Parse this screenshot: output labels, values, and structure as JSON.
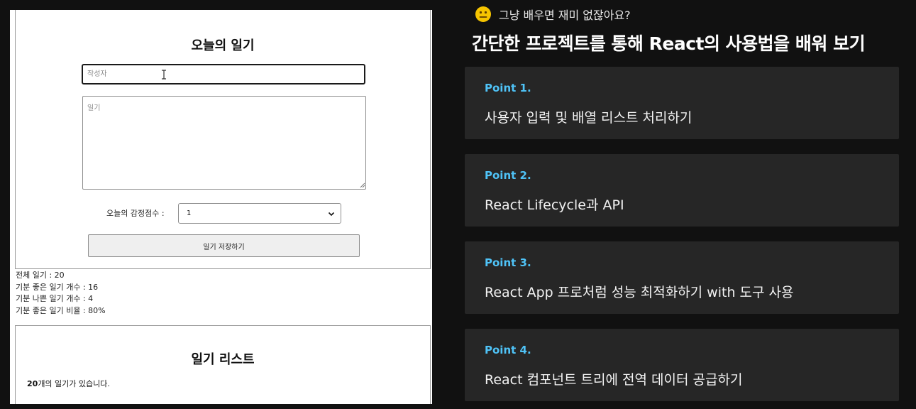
{
  "app": {
    "editor": {
      "title": "오늘의 일기",
      "author_placeholder": "작성자",
      "author_value": "",
      "content_placeholder": "일기",
      "emotion_label": "오늘의 감정점수 :",
      "emotion_value": "1",
      "save_label": "일기 저장하기"
    },
    "stats": {
      "total": "전체 일기 : 20",
      "good": "기분 좋은 일기 개수 : 16",
      "bad": "기분 나쁜 일기 개수 : 4",
      "ratio": "기분 좋은 일기 비율 : 80%"
    },
    "list": {
      "title": "일기 리스트",
      "count_num": "20",
      "count_suffix": "개의 일기가 있습니다."
    }
  },
  "slide": {
    "emoji_icon": "neutral-face-emoji",
    "subtitle": "그냥 배우면 재미 없잖아요?",
    "title": "간단한 프로젝트를 통해 React의 사용법을 배워 보기",
    "accent_color": "#4fc3f7",
    "points": [
      {
        "label": "Point 1.",
        "text": "사용자 입력 및 배열 리스트 처리하기"
      },
      {
        "label": "Point 2.",
        "text": "React Lifecycle과 API"
      },
      {
        "label": "Point 3.",
        "text": "React App 프로처럼 성능 최적화하기 with 도구 사용"
      },
      {
        "label": "Point 4.",
        "text": "React 컴포넌트 트리에 전역 데이터 공급하기"
      }
    ]
  }
}
